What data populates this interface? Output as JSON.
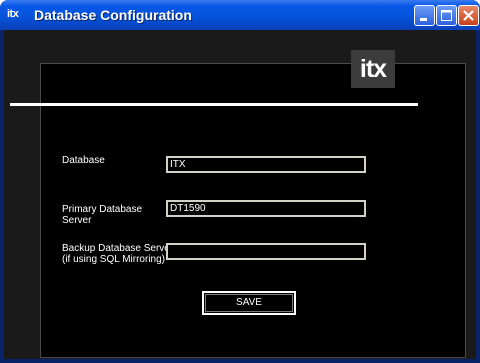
{
  "window": {
    "title": "Database Configuration",
    "app_icon_text": "itx",
    "buttons": [
      "minimize",
      "maximize",
      "close"
    ]
  },
  "logo": {
    "text": "itx"
  },
  "form": {
    "fields": [
      {
        "label": "Database",
        "value": "ITX"
      },
      {
        "label_line1": "Primary Database",
        "label_line2": "Server",
        "value": "DT1590"
      },
      {
        "label_line1": "Backup Database Server",
        "label_line2": "(if using SQL Mirroring)",
        "value": ""
      }
    ],
    "save_label": "SAVE"
  },
  "colors": {
    "titlebar": "#0858e8",
    "background": "#000000",
    "text": "#ffffff",
    "close_button": "#c8401c"
  }
}
